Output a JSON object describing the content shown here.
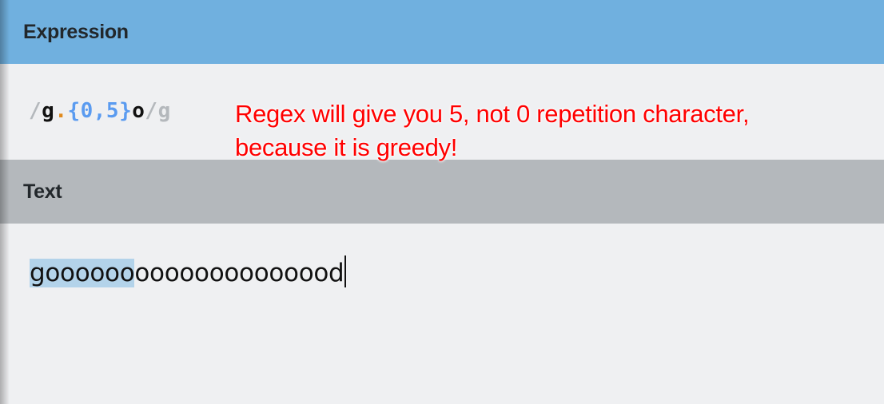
{
  "expression_panel": {
    "title": "Expression"
  },
  "expression": {
    "open_delim": "/",
    "literal_g": "g",
    "dot": ".",
    "quantifier": "{0,5}",
    "literal_o": "o",
    "close_delim": "/",
    "flags": "g"
  },
  "annotation": {
    "line1": "Regex will give you 5, not 0 repetition character,",
    "line2": "because it is greedy!"
  },
  "text_panel": {
    "title": "Text"
  },
  "text": {
    "match": "goooooo",
    "rest": "oooooooooooood"
  },
  "colors": {
    "header_expression": "#70b0df",
    "header_text": "#b4b8bc",
    "match_highlight": "#b3d3ea",
    "annotation": "#ff0000"
  }
}
